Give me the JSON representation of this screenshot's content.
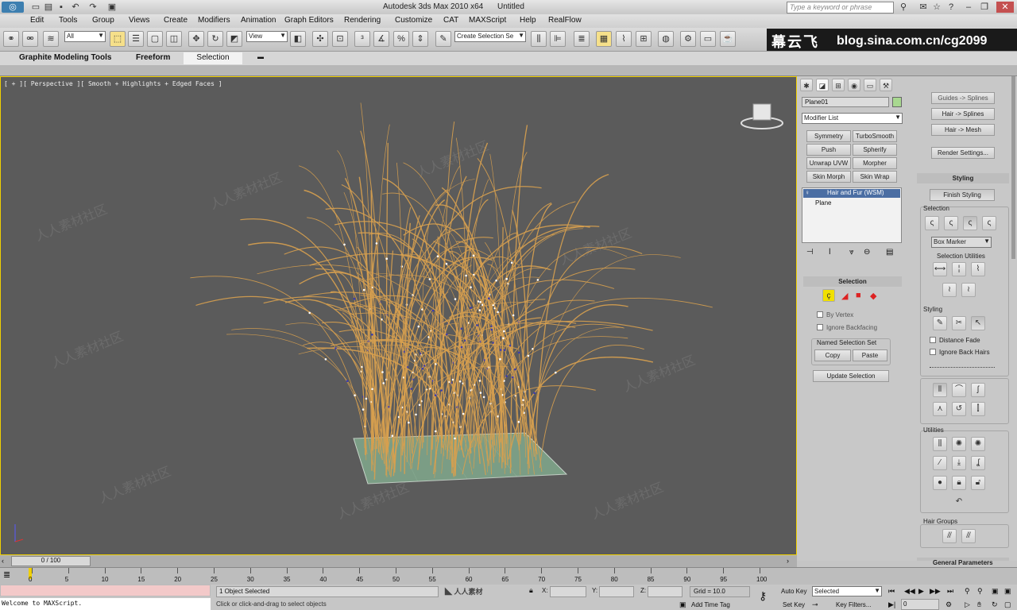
{
  "titlebar": {
    "app_title": "Autodesk 3ds Max  2010 x64",
    "doc_title": "Untitled",
    "search_placeholder": "Type a keyword or phrase"
  },
  "menu": [
    "Edit",
    "Tools",
    "Group",
    "Views",
    "Create",
    "Modifiers",
    "Animation",
    "Graph Editors",
    "Rendering",
    "Customize",
    "CAT",
    "MAXScript",
    "Help",
    "RealFlow"
  ],
  "toolbar": {
    "filter_value": "All",
    "refcoord_value": "View",
    "named_sel_value": "Create Selection Se"
  },
  "brand": {
    "cn": "幕云飞",
    "url": "blog.sina.com.cn/cg2099"
  },
  "ribbon": {
    "tabs": [
      "Graphite Modeling Tools",
      "Freeform",
      "Selection"
    ]
  },
  "viewport": {
    "label": "[ + ][ Perspective ][ Smooth + Highlights + Edged Faces ]",
    "watermark": "人人素材社区",
    "colors": {
      "hair": "#d7a04f",
      "plane": "#7fa58a",
      "background": "#5b5b5b"
    }
  },
  "command_panel": {
    "object_name": "Plane01",
    "modifier_list": "Modifier List",
    "modifier_buttons": [
      "Symmetry",
      "TurboSmooth",
      "Push",
      "Spherify",
      "Unwrap UVW",
      "Morpher",
      "Skin Morph",
      "Skin Wrap"
    ],
    "stack": [
      "Hair and Fur (WSM)",
      "Plane"
    ],
    "selection_rollout": "Selection",
    "by_vertex": "By Vertex",
    "ignore_backfacing": "Ignore Backfacing",
    "named_selection_set": "Named Selection Set",
    "copy": "Copy",
    "paste": "Paste",
    "update_selection": "Update Selection"
  },
  "hair_panel": {
    "guides_to_splines": "Guides -> Splines",
    "hair_to_splines": "Hair -> Splines",
    "hair_to_mesh": "Hair -> Mesh",
    "render_settings": "Render Settings...",
    "styling_rollout": "Styling",
    "finish_styling": "Finish Styling",
    "selection_label": "Selection",
    "box_marker": "Box Marker",
    "selection_utilities": "Selection Utilities",
    "styling_label": "Styling",
    "distance_fade": "Distance Fade",
    "ignore_back_hairs": "Ignore Back Hairs",
    "utilities_label": "Utilities",
    "hair_groups_label": "Hair Groups",
    "general_parameters": "General Parameters"
  },
  "timeline": {
    "frame": "0 / 100",
    "ticks": [
      "0",
      "5",
      "10",
      "15",
      "20",
      "25",
      "30",
      "35",
      "40",
      "45",
      "50",
      "55",
      "60",
      "65",
      "70",
      "75",
      "80",
      "85",
      "90",
      "95",
      "100"
    ]
  },
  "status": {
    "maxscript": "Welcome to MAXScript.",
    "selected": "1 Object Selected",
    "prompt": "Click or click-and-drag to select objects",
    "x_label": "X:",
    "y_label": "Y:",
    "z_label": "Z:",
    "grid": "Grid = 10.0",
    "add_time_tag": "Add Time Tag",
    "auto_key": "Auto Key",
    "set_key": "Set Key",
    "key_mode": "Selected",
    "key_filters": "Key Filters...",
    "frame_value": "0"
  }
}
